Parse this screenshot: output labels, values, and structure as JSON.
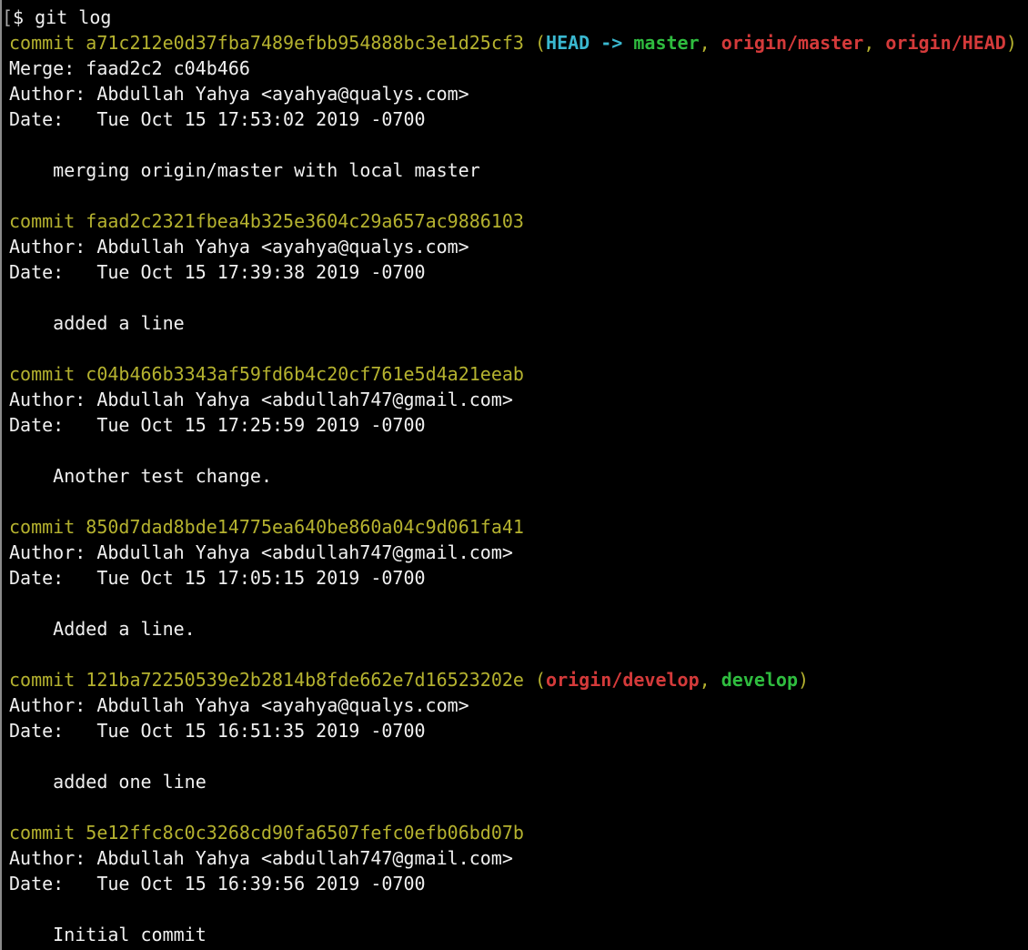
{
  "colors": {
    "background": "#000000",
    "text": "#f0f0f0",
    "commit_hash": "#b5b22f",
    "head_ref": "#3ab8d0",
    "local_branch": "#2fbd3f",
    "remote_branch": "#d43a3a"
  },
  "prompt": {
    "bracket": "[",
    "symbol": "$",
    "command": "git log"
  },
  "commits": [
    {
      "label": "commit",
      "hash": "a71c212e0d37fba7489efbb954888bc3e1d25cf3",
      "refs": {
        "head": "HEAD",
        "arrow": "->",
        "local": "master",
        "remote1": "origin/master",
        "remote2": "origin/HEAD"
      },
      "merge": "Merge: faad2c2 c04b466",
      "author": "Author: Abdullah Yahya <ayahya@qualys.com>",
      "date": "Date:   Tue Oct 15 17:53:02 2019 -0700",
      "message": "    merging origin/master with local master"
    },
    {
      "label": "commit",
      "hash": "faad2c2321fbea4b325e3604c29a657ac9886103",
      "author": "Author: Abdullah Yahya <ayahya@qualys.com>",
      "date": "Date:   Tue Oct 15 17:39:38 2019 -0700",
      "message": "    added a line"
    },
    {
      "label": "commit",
      "hash": "c04b466b3343af59fd6b4c20cf761e5d4a21eeab",
      "author": "Author: Abdullah Yahya <abdullah747@gmail.com>",
      "date": "Date:   Tue Oct 15 17:25:59 2019 -0700",
      "message": "    Another test change."
    },
    {
      "label": "commit",
      "hash": "850d7dad8bde14775ea640be860a04c9d061fa41",
      "author": "Author: Abdullah Yahya <abdullah747@gmail.com>",
      "date": "Date:   Tue Oct 15 17:05:15 2019 -0700",
      "message": "    Added a line."
    },
    {
      "label": "commit",
      "hash": "121ba72250539e2b2814b8fde662e7d16523202e",
      "refs": {
        "remote": "origin/develop",
        "local": "develop"
      },
      "author": "Author: Abdullah Yahya <ayahya@qualys.com>",
      "date": "Date:   Tue Oct 15 16:51:35 2019 -0700",
      "message": "    added one line"
    },
    {
      "label": "commit",
      "hash": "5e12ffc8c0c3268cd90fa6507fefc0efb06bd07b",
      "author": "Author: Abdullah Yahya <abdullah747@gmail.com>",
      "date": "Date:   Tue Oct 15 16:39:56 2019 -0700",
      "message": "    Initial commit"
    }
  ]
}
